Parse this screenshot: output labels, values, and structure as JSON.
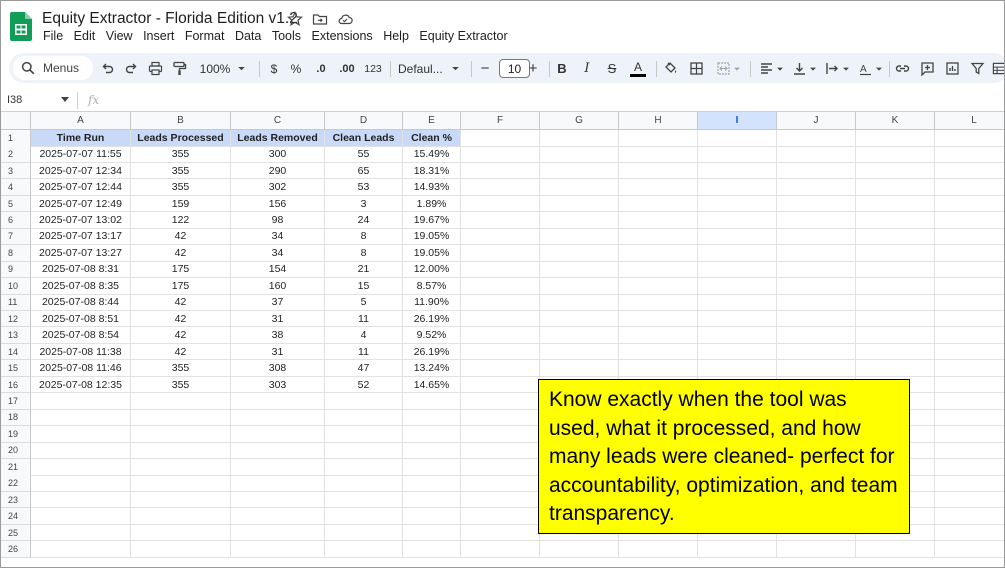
{
  "app": {
    "title": "Equity Extractor - Florida Edition v1.2",
    "icons": [
      "star-icon",
      "move-to-folder-icon",
      "cloud-saved-icon"
    ]
  },
  "menu": [
    "File",
    "Edit",
    "View",
    "Insert",
    "Format",
    "Data",
    "Tools",
    "Extensions",
    "Help",
    "Equity Extractor"
  ],
  "toolbar": {
    "search_label": "Menus",
    "zoom": "100%",
    "currency": "$",
    "percent": "%",
    "dec_decrease": ".0",
    "dec_increase": ".00",
    "number_format": "123",
    "font": "Defaul...",
    "font_size": "10",
    "minus": "−",
    "plus": "+"
  },
  "formula_bar": {
    "name_box": "I38",
    "fx": "fx"
  },
  "columns": [
    "A",
    "B",
    "C",
    "D",
    "E",
    "F",
    "G",
    "H",
    "I",
    "J",
    "K",
    "L"
  ],
  "selected_column": "I",
  "row_numbers": [
    "1",
    "2",
    "3",
    "4",
    "5",
    "6",
    "7",
    "8",
    "9",
    "10",
    "11",
    "12",
    "13",
    "14",
    "15",
    "16",
    "17",
    "18",
    "19",
    "20",
    "21",
    "22",
    "23",
    "24",
    "25",
    "26"
  ],
  "table": {
    "headers": [
      "Time Run",
      "Leads Processed",
      "Leads Removed",
      "Clean Leads",
      "Clean %"
    ],
    "rows": [
      [
        "2025-07-07 11:55",
        "355",
        "300",
        "55",
        "15.49%"
      ],
      [
        "2025-07-07 12:34",
        "355",
        "290",
        "65",
        "18.31%"
      ],
      [
        "2025-07-07 12:44",
        "355",
        "302",
        "53",
        "14.93%"
      ],
      [
        "2025-07-07 12:49",
        "159",
        "156",
        "3",
        "1.89%"
      ],
      [
        "2025-07-07 13:02",
        "122",
        "98",
        "24",
        "19.67%"
      ],
      [
        "2025-07-07 13:17",
        "42",
        "34",
        "8",
        "19.05%"
      ],
      [
        "2025-07-07 13:27",
        "42",
        "34",
        "8",
        "19.05%"
      ],
      [
        "2025-07-08 8:31",
        "175",
        "154",
        "21",
        "12.00%"
      ],
      [
        "2025-07-08 8:35",
        "175",
        "160",
        "15",
        "8.57%"
      ],
      [
        "2025-07-08 8:44",
        "42",
        "37",
        "5",
        "11.90%"
      ],
      [
        "2025-07-08 8:51",
        "42",
        "31",
        "11",
        "26.19%"
      ],
      [
        "2025-07-08 8:54",
        "42",
        "38",
        "4",
        "9.52%"
      ],
      [
        "2025-07-08 11:38",
        "42",
        "31",
        "11",
        "26.19%"
      ],
      [
        "2025-07-08 11:46",
        "355",
        "308",
        "47",
        "13.24%"
      ],
      [
        "2025-07-08 12:35",
        "355",
        "303",
        "52",
        "14.65%"
      ]
    ]
  },
  "callout": {
    "text": "Know exactly when the tool was used, what it processed, and how many leads were cleaned- perfect for accountability, optimization, and team transparency."
  },
  "colors": {
    "header_fill": "#c9daf8",
    "callout_fill": "#ffff00",
    "toolbar_bg": "#eef2f9",
    "sheets_green": "#0f9d58"
  }
}
